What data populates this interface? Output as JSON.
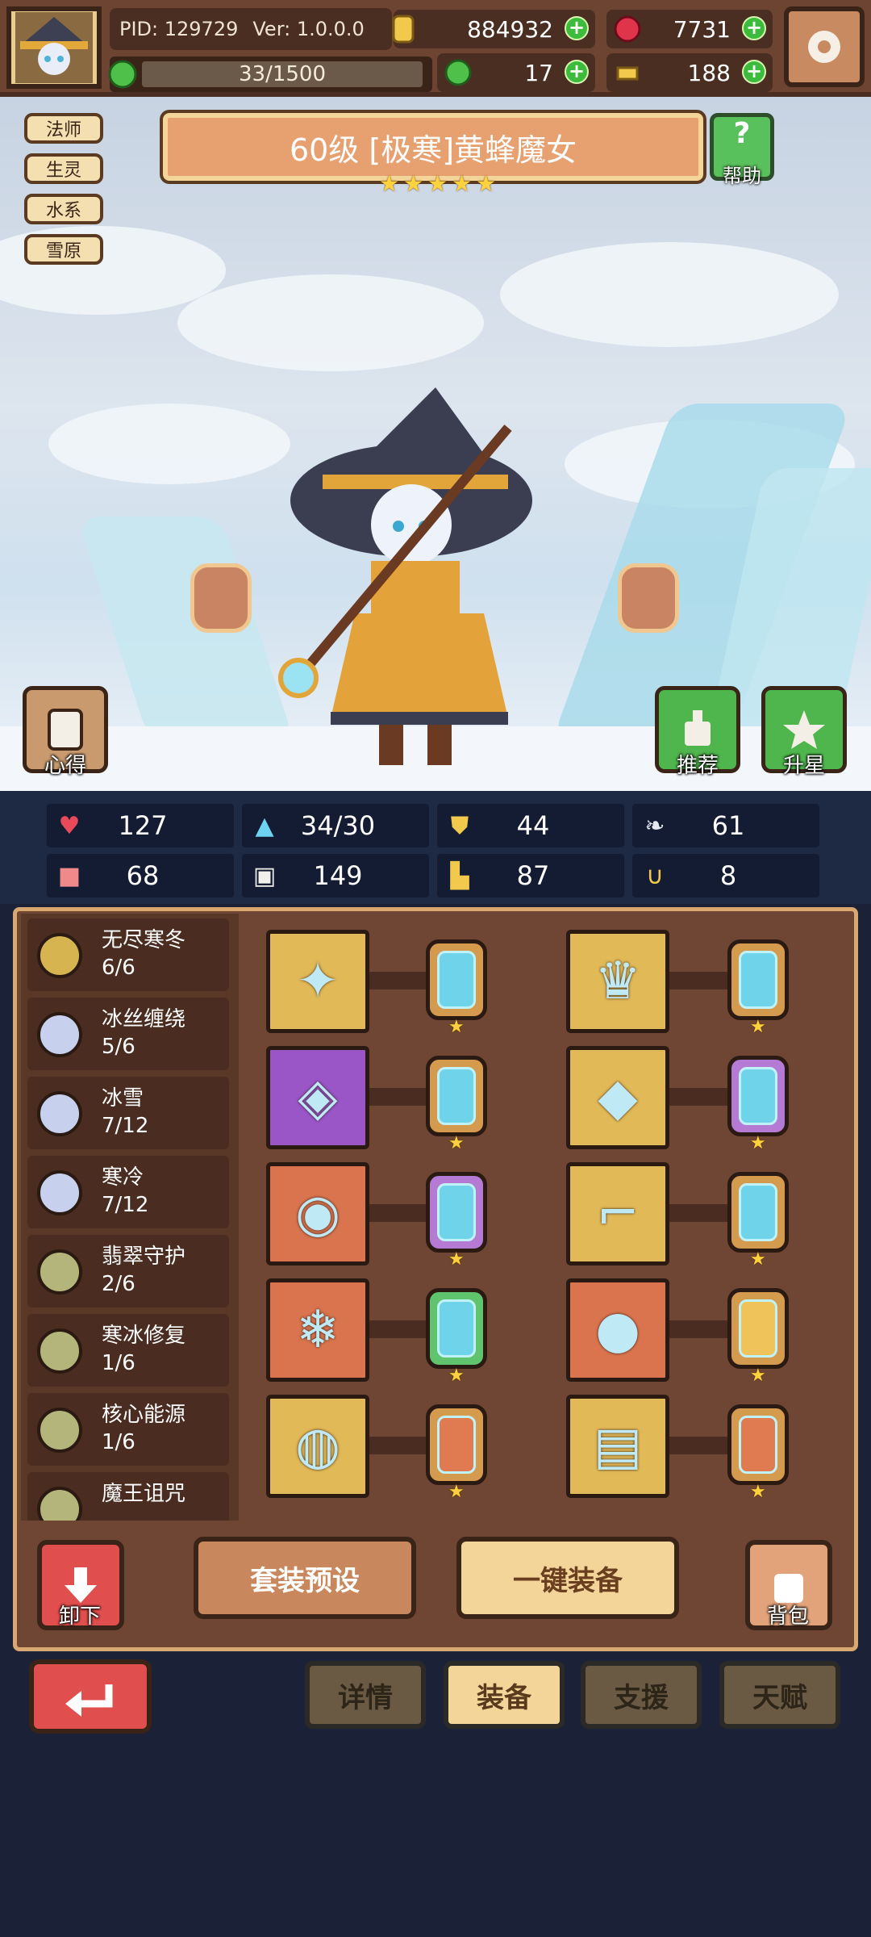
{
  "header": {
    "pid": "PID: 129729",
    "version": "Ver: 1.0.0.0",
    "gold": "884932",
    "ruby": "7731",
    "stamina": "33/1500",
    "clover": "17",
    "key": "188"
  },
  "hero": {
    "title": "60级  [极寒]黄蜂魔女",
    "stars": 5,
    "tags": [
      "法师",
      "生灵",
      "水系",
      "雪原"
    ],
    "help_label": "帮助",
    "left_button_label": "心得",
    "recommend_label": "推荐",
    "upgrade_label": "升星"
  },
  "stats": [
    {
      "icon": "heart-icon",
      "value": "127"
    },
    {
      "icon": "mana-icon",
      "value": "34/30"
    },
    {
      "icon": "shield-icon",
      "value": "44"
    },
    {
      "icon": "wing-icon",
      "value": "61"
    },
    {
      "icon": "fist-icon",
      "value": "68"
    },
    {
      "icon": "book-icon",
      "value": "149"
    },
    {
      "icon": "boot-icon",
      "value": "87"
    },
    {
      "icon": "horseshoe-icon",
      "value": "8"
    }
  ],
  "sets": [
    {
      "name": "无尽寒冬",
      "count": "6/6",
      "color": "#d6b450"
    },
    {
      "name": "冰丝缠绕",
      "count": "5/6",
      "color": "#c7d0ec"
    },
    {
      "name": "冰雪",
      "count": "7/12",
      "color": "#c7d0ec"
    },
    {
      "name": "寒冷",
      "count": "7/12",
      "color": "#c7d0ec"
    },
    {
      "name": "翡翠守护",
      "count": "2/6",
      "color": "#b4b57a"
    },
    {
      "name": "寒冰修复",
      "count": "1/6",
      "color": "#b4b57a"
    },
    {
      "name": "核心能源",
      "count": "1/6",
      "color": "#b4b57a"
    },
    {
      "name": "魔王诅咒",
      "count": "",
      "color": "#b4b57a"
    }
  ],
  "equipment_left": [
    {
      "name": "wand-icon",
      "bg": "#e2b957",
      "rune": "#6fd3e9",
      "rune_border": "#d49a4d",
      "glyph": "✦"
    },
    {
      "name": "amulet-icon",
      "bg": "#9a56c7",
      "rune": "#6fd3e9",
      "rune_border": "#d49a4d",
      "glyph": "◈"
    },
    {
      "name": "necklace-icon",
      "bg": "#d9744e",
      "rune": "#6fd3e9",
      "rune_border": "#b57ad3",
      "glyph": "◉"
    },
    {
      "name": "ice-crystal-icon",
      "bg": "#d9744e",
      "rune": "#6fd3e9",
      "rune_border": "#5fc46d",
      "glyph": "❄"
    },
    {
      "name": "ring-icon",
      "bg": "#e2b957",
      "rune": "#e07a50",
      "rune_border": "#d49a4d",
      "glyph": "◍"
    }
  ],
  "equipment_right": [
    {
      "name": "crown-icon",
      "bg": "#e2b957",
      "rune": "#6fd3e9",
      "rune_border": "#d49a4d",
      "glyph": "♛"
    },
    {
      "name": "armor-icon",
      "bg": "#e2b957",
      "rune": "#6fd3e9",
      "rune_border": "#b57ad3",
      "glyph": "◆"
    },
    {
      "name": "boots-icon",
      "bg": "#e2b957",
      "rune": "#6fd3e9",
      "rune_border": "#d49a4d",
      "glyph": "⌐"
    },
    {
      "name": "dark-orb-icon",
      "bg": "#d9744e",
      "rune": "#f0c35a",
      "rune_border": "#d49a4d",
      "glyph": "●"
    },
    {
      "name": "scroll-icon",
      "bg": "#e2b957",
      "rune": "#e07a50",
      "rune_border": "#d49a4d",
      "glyph": "▤"
    }
  ],
  "actions": {
    "unequip_label": "卸下",
    "preset_label": "套装预设",
    "auto_equip_label": "一键装备",
    "bag_label": "背包"
  },
  "tabs": [
    "详情",
    "装备",
    "支援",
    "天赋"
  ],
  "active_tab": "装备"
}
